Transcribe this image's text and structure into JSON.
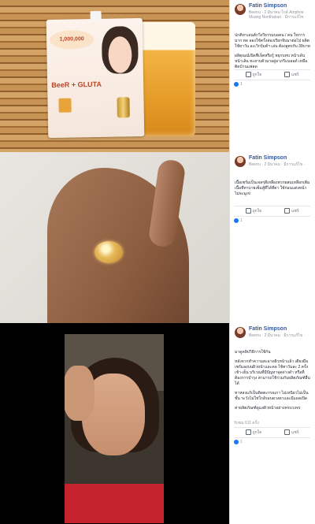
{
  "posts": [
    {
      "author": "Fatin Simpson",
      "meta": "Beerru · 2 มีนาคม ใกล้ Amphoe Muang Nonthaburi · มีการแก้ไข ·",
      "text": [
        "ปกติทาเอนต์กวิ่งวีธรรมบอคน / คน ใหการมาก ทด ลองใช้ครั้งส่องเรียกจีบมาต่อไป ผลิต ใช้ทาวัน ละเวิกรุ้มต์ฯ เล่น ต้องสูตรกับ 39บาท",
        "ผลิตุณณ์เปิดฟีเจ็ตหรือรู้ หยุกบทบ หน้าเล้น หน้าเล้น ทะยาบตัวมาอยู่อาภรีแบลอด์ เหมือติดบ้านแพลด"
      ],
      "like_label": "ถูกใจ",
      "share_label": "แชร์",
      "reactions": "1"
    },
    {
      "author": "Fatin Simpson",
      "meta": "Beerru · 2 มีนาคม · มีการแก้ไข ·",
      "text": [
        "เนื้อเซรั่มเป็นเจลๆสีเหลืองพวกผสมเหลือกเพิ่มเนื้อที่ทาบายเซ็มสู้ที่ได้ที่ตา ใช้ก่อนแต่งหน้าไม่จะมูเข่"
      ],
      "like_label": "ถูกใจ",
      "share_label": "แชร์",
      "reactions": "1"
    },
    {
      "author": "Fatin Simpson",
      "meta": "Beerru · 2 มีนาคม · มีการแก้ไข ·",
      "text": [
        "มาดูคลิปวิธีการใช้กัน",
        "หลังจากทำความสะอาดผิวหน้าแล้ว เตียงมือเซรั่มลงบนผิวหน้าและคอ ใช้ทาวันละ 2 ครั้ง เช้า-เย็น บริเวณที่มีปัญหาจุดด่างดำ หรือที่ต้องการบำรุง สามารถใช้ร่วมกับผลิตภัณฑ์อื่นได้",
        "ทาหลงแก้เป็นติดตะกรอเกา ไม่เหนียวไม่เป็นชั้น ระวังไม่ใช่ใกล้รอบดวงตาและมีแผลเปิด",
        "ค่าผลิตภัณฑ์ดูแลผิวหน้าอย่างครบวงจร"
      ],
      "views": "รับชม 611 ครั้ง",
      "like_label": "ถูกใจ",
      "share_label": "แชร์",
      "reactions": "1"
    }
  ],
  "product": {
    "badge": "1,000,000",
    "brand": "BeeR + GLUTA"
  },
  "colors": {
    "link": "#365899",
    "meta": "#90949c",
    "reaction": "#1877f2",
    "bamboo": "#b07a3d",
    "beer": "#e9a63a"
  }
}
